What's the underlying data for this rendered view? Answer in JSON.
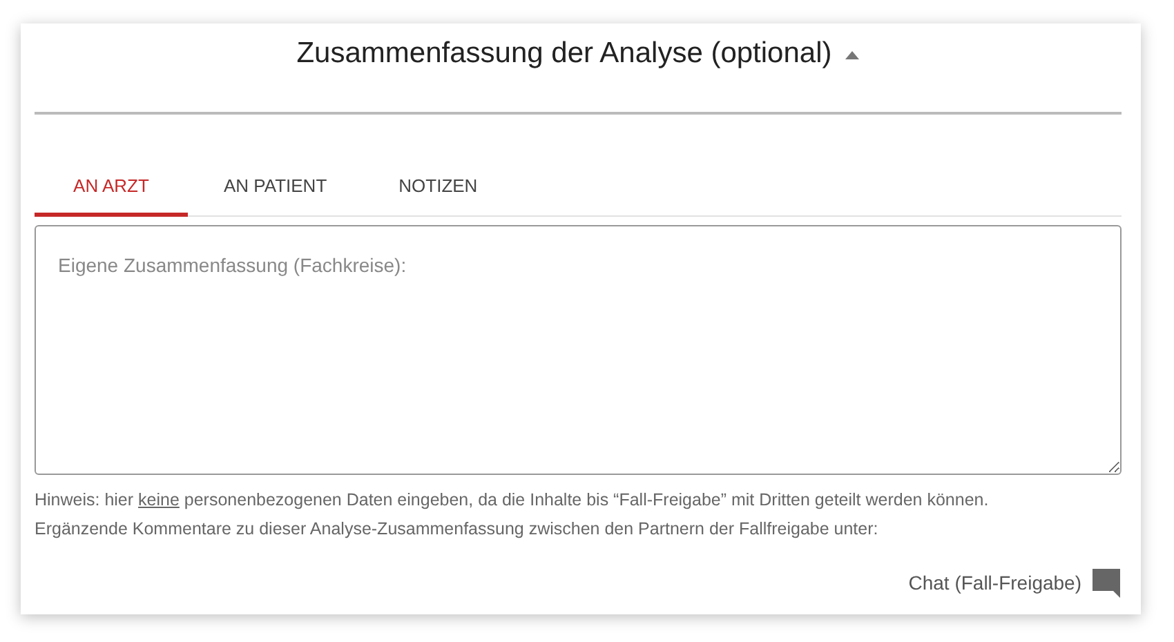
{
  "section": {
    "title": "Zusammenfassung der Analyse (optional)",
    "expanded": true
  },
  "tabs": [
    {
      "label": "AN ARZT",
      "selected": true
    },
    {
      "label": "AN PATIENT",
      "selected": false
    },
    {
      "label": "NOTIZEN",
      "selected": false
    }
  ],
  "summary_field": {
    "placeholder": "Eigene Zusammenfassung (Fachkreise):"
  },
  "hint": {
    "before": "Hinweis: hier ",
    "underlined": "keine",
    "after": " personenbezogenen Daten eingeben, da die Inhalte bis “Fall-Freigabe” mit Dritten geteilt werden können."
  },
  "comment_note": "Ergänzende Kommentare zu dieser Analyse-Zusammenfassung zwischen den Partnern der Fallfreigabe unter:",
  "chat_link": {
    "label": "Chat (Fall-Freigabe)"
  }
}
